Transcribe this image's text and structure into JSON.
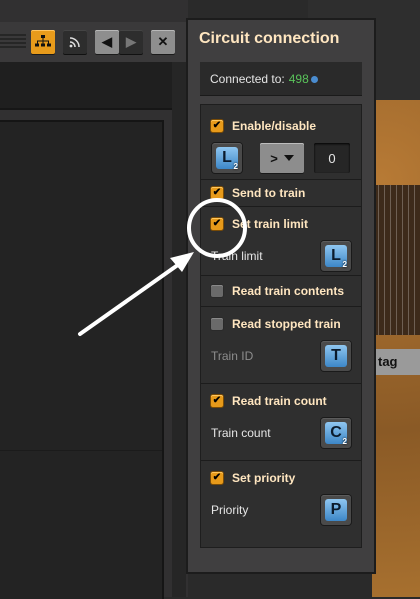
{
  "background_window": {
    "buttons": [
      {
        "icon": "network-tree-icon"
      },
      {
        "icon": "wireless-signal-icon"
      },
      {
        "icon": "arrow-left-icon",
        "text": "◀"
      },
      {
        "icon": "arrow-right-icon",
        "text": "▶"
      },
      {
        "icon": "close-icon",
        "text": "✕"
      }
    ]
  },
  "right_tag": "tag",
  "panel": {
    "title": "Circuit connection",
    "connected_label": "Connected to:",
    "connected_value": "498",
    "enable_disable": {
      "label": "Enable/disable",
      "checked": true,
      "signal": "L",
      "signal_sub": "2",
      "comparator": ">",
      "value": "0"
    },
    "send_to_train": {
      "label": "Send to train",
      "checked": true
    },
    "set_train_limit": {
      "label": "Set train limit",
      "checked": true,
      "sub_label": "Train limit",
      "signal": "L",
      "signal_sub": "2"
    },
    "read_train_contents": {
      "label": "Read train contents",
      "checked": false
    },
    "read_stopped_train": {
      "label": "Read stopped train",
      "checked": false,
      "sub_label": "Train ID",
      "signal": "T"
    },
    "read_train_count": {
      "label": "Read train count",
      "checked": true,
      "sub_label": "Train count",
      "signal": "C",
      "signal_sub": "2"
    },
    "set_priority": {
      "label": "Set priority",
      "checked": true,
      "sub_label": "Priority",
      "signal": "P"
    }
  },
  "colors": {
    "checkbox_on": "#e79a1a",
    "title_text": "#ffe6c0",
    "connected_value": "#59c35a",
    "signal_blue": "#5aa6e0",
    "annotation": "#ffffff"
  }
}
